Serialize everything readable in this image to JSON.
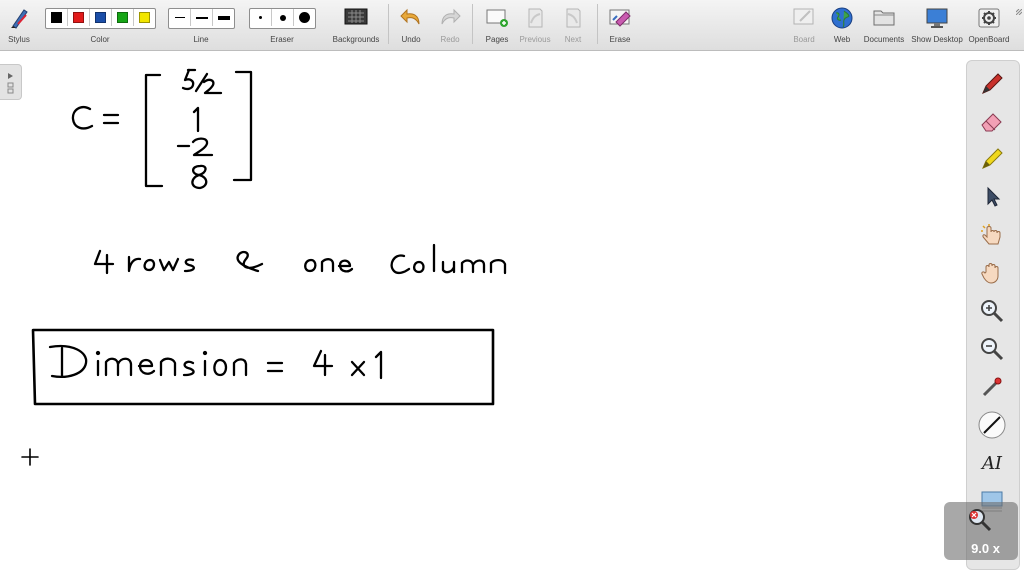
{
  "toolbar": {
    "stylus": "Stylus",
    "color": "Color",
    "line": "Line",
    "eraser": "Eraser",
    "backgrounds": "Backgrounds",
    "undo": "Undo",
    "redo": "Redo",
    "pages": "Pages",
    "previous": "Previous",
    "next": "Next",
    "erase": "Erase",
    "board": "Board",
    "web": "Web",
    "documents": "Documents",
    "show_desktop": "Show Desktop",
    "openboard": "OpenBoard"
  },
  "colors": {
    "palette": [
      "#000000",
      "#e21b1b",
      "#1b4ea8",
      "#16a516",
      "#f2e600"
    ],
    "ink": "#000000"
  },
  "canvas": {
    "matrix_label": "C =",
    "matrix_values": [
      "5/2",
      "1",
      "-2",
      "8"
    ],
    "note": "4 rows & one column",
    "result": "Dimension = 4 x 1"
  },
  "sidebar": {
    "tools": [
      "pen-icon",
      "eraser-tool-icon",
      "highlighter-icon",
      "selector-arrow-icon",
      "pointer-hand-icon",
      "hand-drag-icon",
      "zoom-in-icon",
      "zoom-out-icon",
      "laser-pointer-icon",
      "line-tool-icon",
      "text-tool-icon"
    ],
    "text_tool_glyph": "AI"
  },
  "zoom": {
    "level": "9.0 x"
  }
}
